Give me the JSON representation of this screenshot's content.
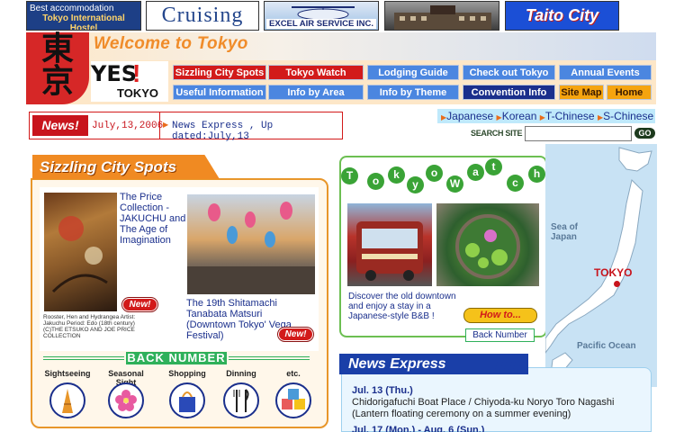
{
  "banners": {
    "hostel_line1": "Best accommodation",
    "hostel_line2": "Tokyo International Hostel",
    "cruising": "Cruising",
    "excel": "EXCEL AIR SERVICE INC.",
    "taito": "Taito City"
  },
  "header": {
    "logo_kanji_1": "東",
    "logo_kanji_2": "京",
    "welcome": "Welcome to Tokyo",
    "yes_logo": "YES",
    "yes_logo_sub": "TOKYO"
  },
  "nav": {
    "sizzling": "Sizzling City Spots",
    "tokyo_watch": "Tokyo Watch",
    "lodging": "Lodging Guide",
    "checkout": "Check out Tokyo",
    "annual": "Annual Events",
    "useful": "Useful Information",
    "area": "Info by Area",
    "theme": "Info by Theme",
    "convention": "Convention Info",
    "sitemap": "Site Map",
    "home": "Home"
  },
  "news": {
    "tag": "News!",
    "date": "July,13,2006",
    "text": "News Express , Up dated:July,13"
  },
  "languages": [
    "Japanese",
    "Korean",
    "T-Chinese",
    "S-Chinese"
  ],
  "search": {
    "label": "SEARCH SITE",
    "value": "",
    "go": "GO"
  },
  "sizzling": {
    "title": "Sizzling City Spots",
    "item1_title": "The Price Collection - JAKUCHU and The Age of Imagination",
    "item1_credit": "Rooster, Hen and Hydrangea Artist: Jakuchu Period: Edo (18th century) (C)THE ETSUKO AND JOE PRICE COLLECTION",
    "item2_title": "The 19th Shitamachi Tanabata Matsuri (Downtown Tokyo' Vega Festival)",
    "new_badge": "New!",
    "back_number": "BACK NUMBER",
    "categories": [
      "Sightseeing",
      "Seasonal Sight",
      "Shopping",
      "Dinning",
      "etc."
    ]
  },
  "tokyo_watch": {
    "title_letters": [
      "T",
      "o",
      "k",
      "y",
      "o",
      "W",
      "a",
      "t",
      "c",
      "h"
    ],
    "text": "Discover the old downtown and enjoy a stay in a Japanese-style B&B !",
    "howto": "How to...",
    "back_number": "Back Number"
  },
  "map": {
    "sea_of_japan": "Sea of Japan",
    "tokyo": "TOKYO",
    "pacific": "Pacific Ocean"
  },
  "news_express": {
    "title": "News Express",
    "date1": "Jul. 13 (Thu.)",
    "item1": "Chidorigafuchi Boat Place / Chiyoda-ku Noryo Toro Nagashi (Lantern floating ceremony on a summer evening)",
    "date2": "Jul. 17 (Mon.) - Aug. 6 (Sun.)"
  },
  "colors": {
    "accent_red": "#d21a1a",
    "accent_blue": "#4b86e0",
    "accent_orange": "#f08a22",
    "accent_green": "#3aa336"
  }
}
